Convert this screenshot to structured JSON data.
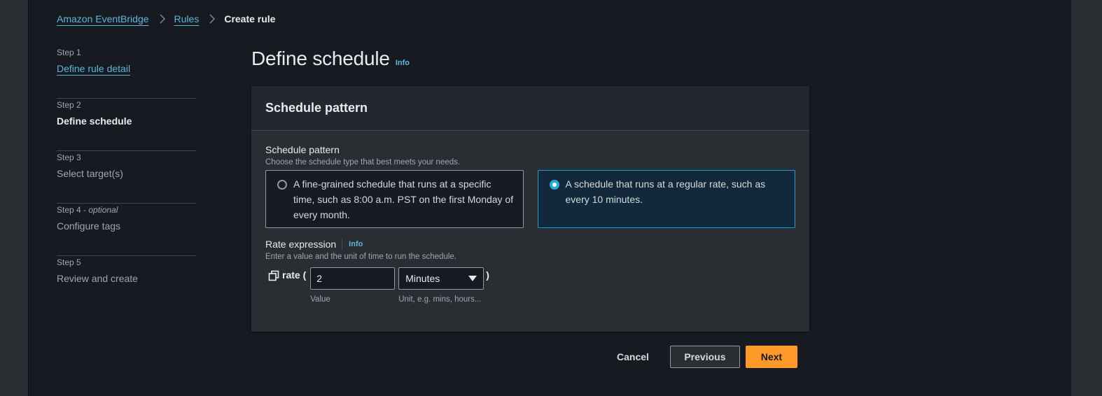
{
  "breadcrumb": {
    "items": [
      {
        "label": "Amazon EventBridge",
        "link": true
      },
      {
        "label": "Rules",
        "link": true
      },
      {
        "label": "Create rule",
        "link": false
      }
    ]
  },
  "steps": [
    {
      "number": "Step 1",
      "optional": "",
      "title": "Define rule detail",
      "state": "link"
    },
    {
      "number": "Step 2",
      "optional": "",
      "title": "Define schedule",
      "state": "current"
    },
    {
      "number": "Step 3",
      "optional": "",
      "title": "Select target(s)",
      "state": "disabled"
    },
    {
      "number": "Step 4 - ",
      "optional": "optional",
      "title": "Configure tags",
      "state": "disabled"
    },
    {
      "number": "Step 5",
      "optional": "",
      "title": "Review and create",
      "state": "disabled"
    }
  ],
  "page": {
    "title": "Define schedule",
    "info_label": "Info"
  },
  "card": {
    "header": "Schedule pattern",
    "schedule_pattern": {
      "label": "Schedule pattern",
      "description": "Choose the schedule type that best meets your needs.",
      "options": [
        {
          "text": "A fine-grained schedule that runs at a specific time, such as 8:00 a.m. PST on the first Monday of every month.",
          "selected": false
        },
        {
          "text": "A schedule that runs at a regular rate, such as every 10 minutes.",
          "selected": true
        }
      ]
    },
    "rate_expression": {
      "label": "Rate expression",
      "info_label": "Info",
      "description": "Enter a value and the unit of time to run the schedule.",
      "prefix": "rate (",
      "suffix": ")",
      "value": "2",
      "value_hint": "Value",
      "unit_selected": "Minutes",
      "unit_hint": "Unit, e.g. mins, hours..."
    }
  },
  "actions": {
    "cancel": "Cancel",
    "previous": "Previous",
    "next": "Next"
  },
  "colors": {
    "accent_link": "#5ab8d9",
    "primary_button": "#ff9a28",
    "selected_border": "#0aa4d8"
  }
}
